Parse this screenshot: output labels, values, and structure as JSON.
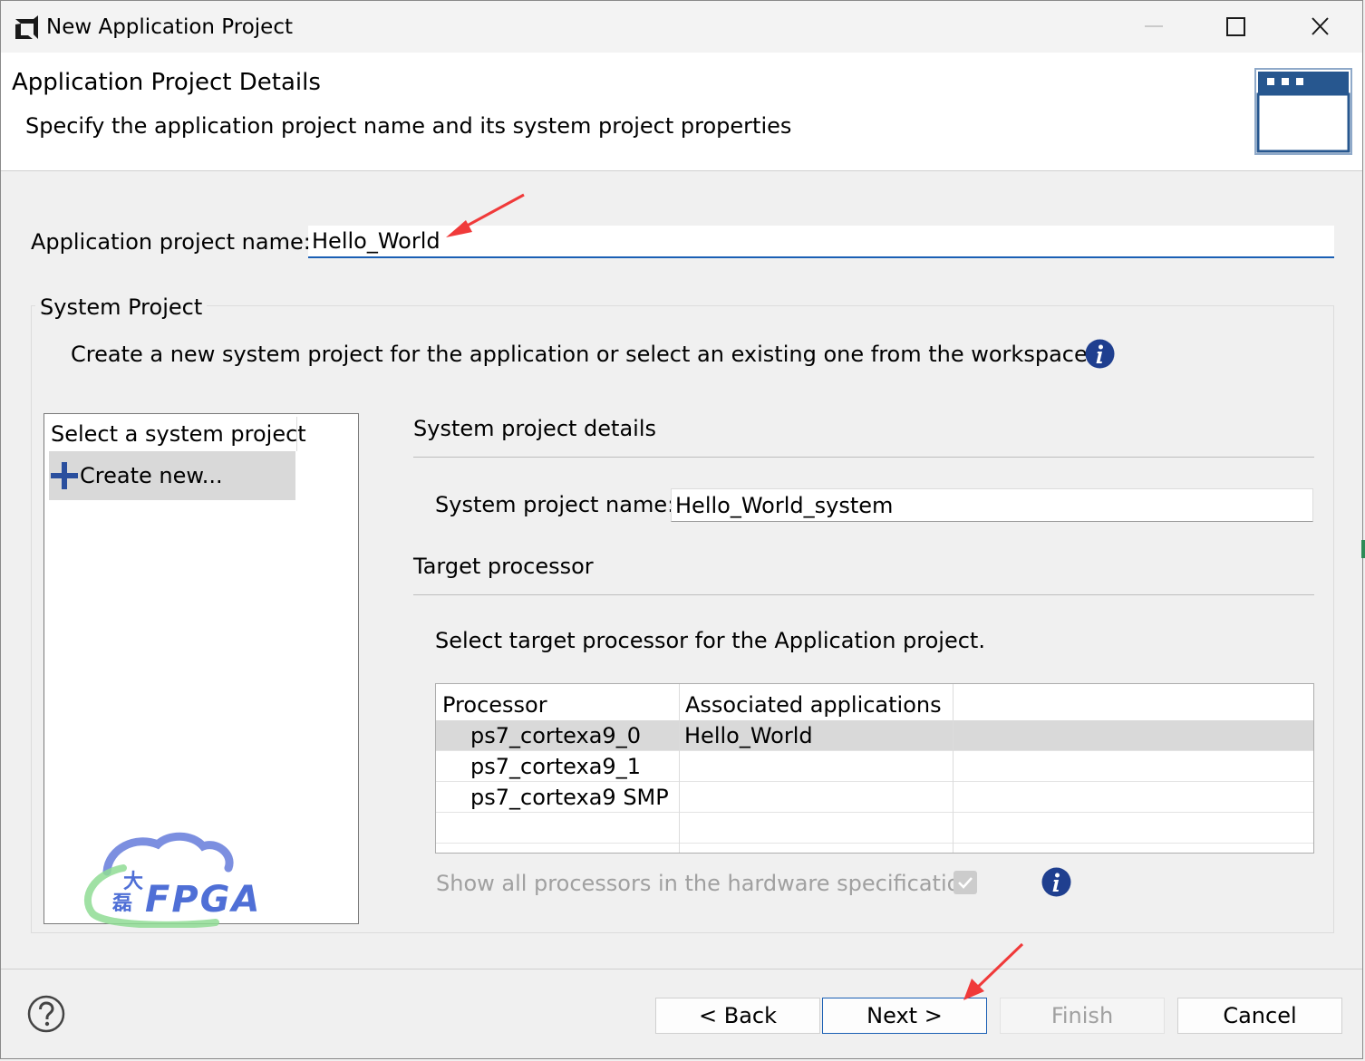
{
  "window": {
    "title": "New Application Project"
  },
  "header": {
    "title": "Application Project Details",
    "description": "Specify the application project name and its system project properties"
  },
  "app_project": {
    "label": "Application project name:",
    "value": "Hello_World"
  },
  "system_project": {
    "group_title": "System Project",
    "description": "Create a new system project for the application or select an existing one from the workspace",
    "list": {
      "header": "Select a system project",
      "items": [
        {
          "label": "Create new..."
        }
      ]
    },
    "details": {
      "heading": "System project details",
      "name_label": "System project name:",
      "name_value": "Hello_World_system"
    },
    "target": {
      "heading": "Target processor",
      "description": "Select target processor for the Application project.",
      "columns": [
        "Processor",
        "Associated applications"
      ],
      "rows": [
        {
          "processor": "ps7_cortexa9_0",
          "apps": "Hello_World"
        },
        {
          "processor": "ps7_cortexa9_1",
          "apps": ""
        },
        {
          "processor": "ps7_cortexa9 SMP",
          "apps": ""
        }
      ],
      "show_all_label": "Show all processors in the hardware specification",
      "show_all_checked": true
    }
  },
  "logo": {
    "text": "FPGA",
    "chars": [
      "大",
      "磊"
    ]
  },
  "footer": {
    "back": "< Back",
    "next": "Next >",
    "finish": "Finish",
    "cancel": "Cancel"
  },
  "colors": {
    "accent": "#1a5fb4",
    "info_icon": "#1f3f8f",
    "annotation_arrow": "#f03a3a",
    "selected_row": "#d9d9d9",
    "plus_icon": "#2a4f9e",
    "logo_blue": "#4f6fd6",
    "logo_green": "#7ed08a"
  },
  "icons": {
    "app": "amd-logo-icon",
    "minimize": "minimize-icon",
    "maximize": "maximize-icon",
    "close": "close-icon",
    "banner": "window-wizard-icon",
    "info": "info-icon",
    "plus": "plus-icon",
    "help": "help-icon",
    "check": "check-icon"
  }
}
